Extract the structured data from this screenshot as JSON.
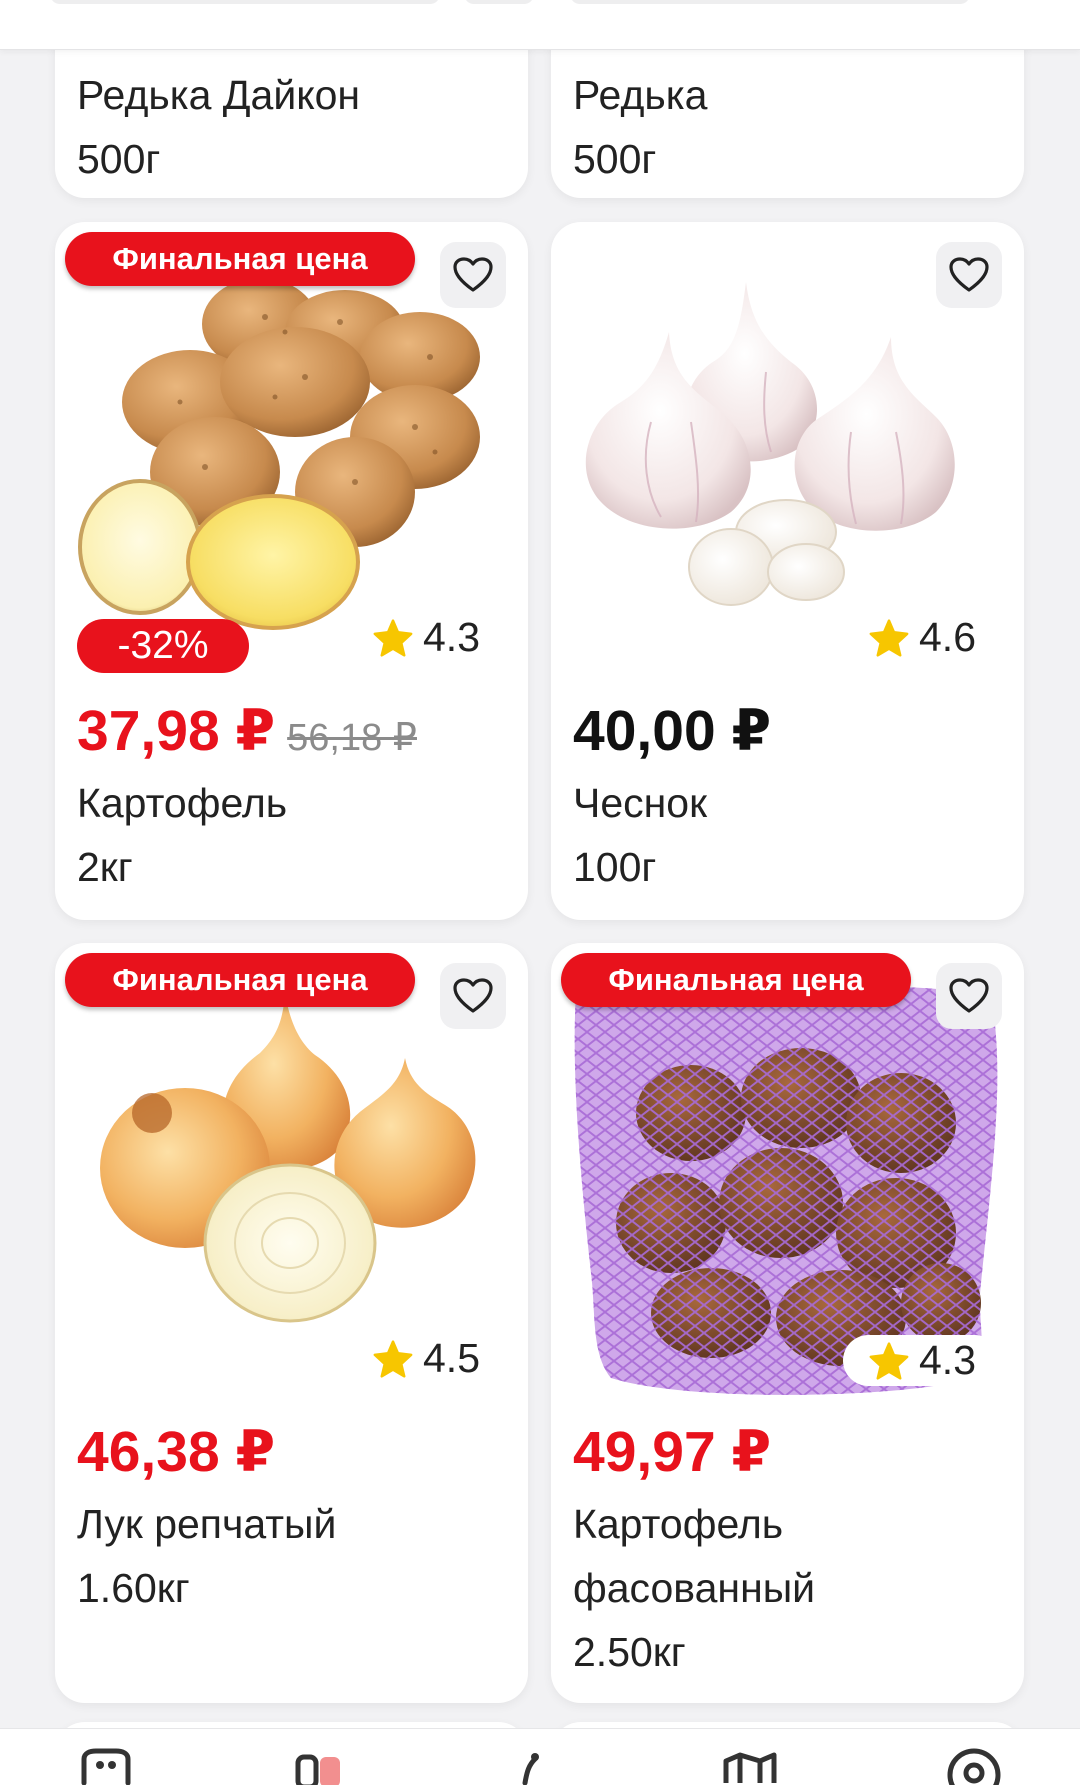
{
  "top_card_row": [
    {
      "name": "Редька Дайкон",
      "weight": "500г"
    },
    {
      "name": "Редька",
      "weight": "500г"
    }
  ],
  "products": [
    {
      "badge": "Финальная цена",
      "discount": "-32%",
      "rating": "4.3",
      "price": "37,98 ₽",
      "old_price": "56,18 ₽",
      "name": "Картофель",
      "weight": "2кг"
    },
    {
      "rating": "4.6",
      "price": "40,00 ₽",
      "name": "Чеснок",
      "weight": "100г"
    },
    {
      "badge": "Финальная цена",
      "rating": "4.5",
      "price": "46,38 ₽",
      "name": "Лук репчатый",
      "weight": "1.60кг"
    },
    {
      "badge": "Финальная цена",
      "rating": "4.3",
      "price": "49,97 ₽",
      "name_line1": "Картофель",
      "name_line2": "фасованный",
      "weight": "2.50кг"
    }
  ],
  "icons": {
    "favorite": "heart-outline-icon",
    "rating": "star-icon"
  },
  "colors": {
    "accent_red": "#e8121c",
    "star_yellow": "#f7c600",
    "background": "#f2f2f4"
  }
}
